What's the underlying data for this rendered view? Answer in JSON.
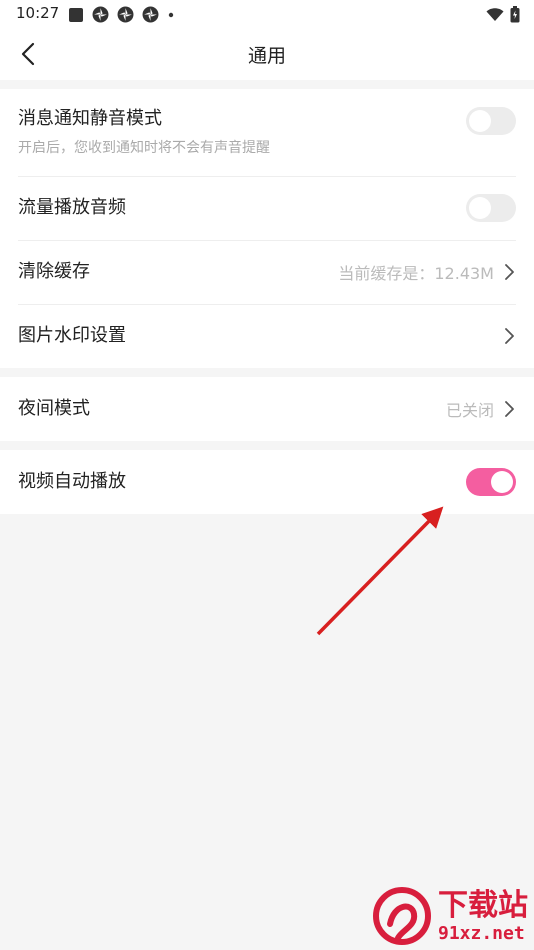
{
  "status_bar": {
    "time": "10:27"
  },
  "header": {
    "title": "通用"
  },
  "settings": {
    "message_silent": {
      "label": "消息通知静音模式",
      "sub": "开启后，您收到通知时将不会有声音提醒",
      "enabled": false
    },
    "data_audio": {
      "label": "流量播放音频",
      "enabled": false
    },
    "clear_cache": {
      "label": "清除缓存",
      "value": "当前缓存是：12.43M"
    },
    "watermark": {
      "label": "图片水印设置"
    },
    "night_mode": {
      "label": "夜间模式",
      "value": "已关闭"
    },
    "video_autoplay": {
      "label": "视频自动播放",
      "enabled": true
    }
  },
  "watermark_brand": {
    "cn": "下载站",
    "url": "91xz.net"
  },
  "colors": {
    "accent": "#f45ea0",
    "toggle_off": "#ececec",
    "annotation_arrow": "#d82020"
  }
}
